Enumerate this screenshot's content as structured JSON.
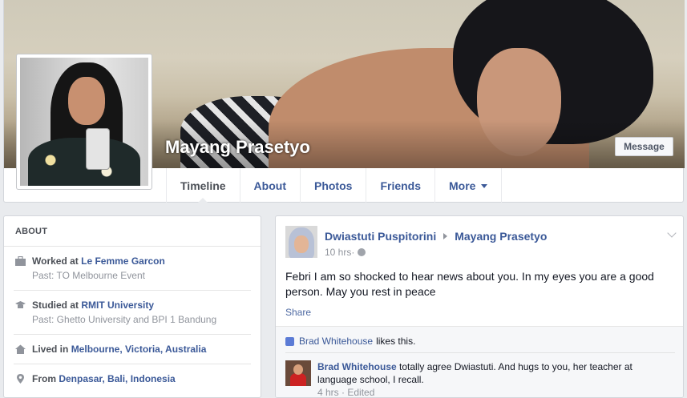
{
  "profile": {
    "name": "Mayang Prasetyo",
    "message_label": "Message"
  },
  "tabs": [
    {
      "label": "Timeline",
      "active": true
    },
    {
      "label": "About"
    },
    {
      "label": "Photos"
    },
    {
      "label": "Friends"
    },
    {
      "label": "More"
    }
  ],
  "about": {
    "title": "ABOUT",
    "work": {
      "prefix": "Worked at ",
      "place": "Le Femme Garcon",
      "past": "Past: TO Melbourne Event"
    },
    "study": {
      "prefix": "Studied at ",
      "place": "RMIT University",
      "past": "Past: Ghetto University and BPI 1 Bandung"
    },
    "lived": {
      "prefix": "Lived in ",
      "place": "Melbourne, Victoria, Australia"
    },
    "from": {
      "prefix": "From ",
      "place": "Denpasar, Bali, Indonesia"
    }
  },
  "post": {
    "author": "Dwiastuti Puspitorini",
    "target": "Mayang Prasetyo",
    "time": "10 hrs",
    "meta_separator": " · ",
    "text": "Febri I am so shocked to hear news about you. In my eyes you are a good person. May you rest in peace",
    "share_label": "Share",
    "likes": {
      "name": "Brad Whitehouse",
      "suffix": "likes this."
    },
    "comment": {
      "author": "Brad Whitehouse",
      "text": " totally agree Dwiastuti. And hugs to you, her teacher at language school, I recall.",
      "time": "4 hrs",
      "meta_separator": " · ",
      "edited": "Edited"
    }
  },
  "icons": {
    "work": "briefcase-icon",
    "study": "graduation-cap-icon",
    "lived": "house-icon",
    "from": "map-pin-icon",
    "privacy": "globe-icon",
    "like": "thumbs-up-icon"
  },
  "colors": {
    "link": "#3b5998",
    "page_bg": "#e9ebee",
    "muted": "#90949c"
  }
}
